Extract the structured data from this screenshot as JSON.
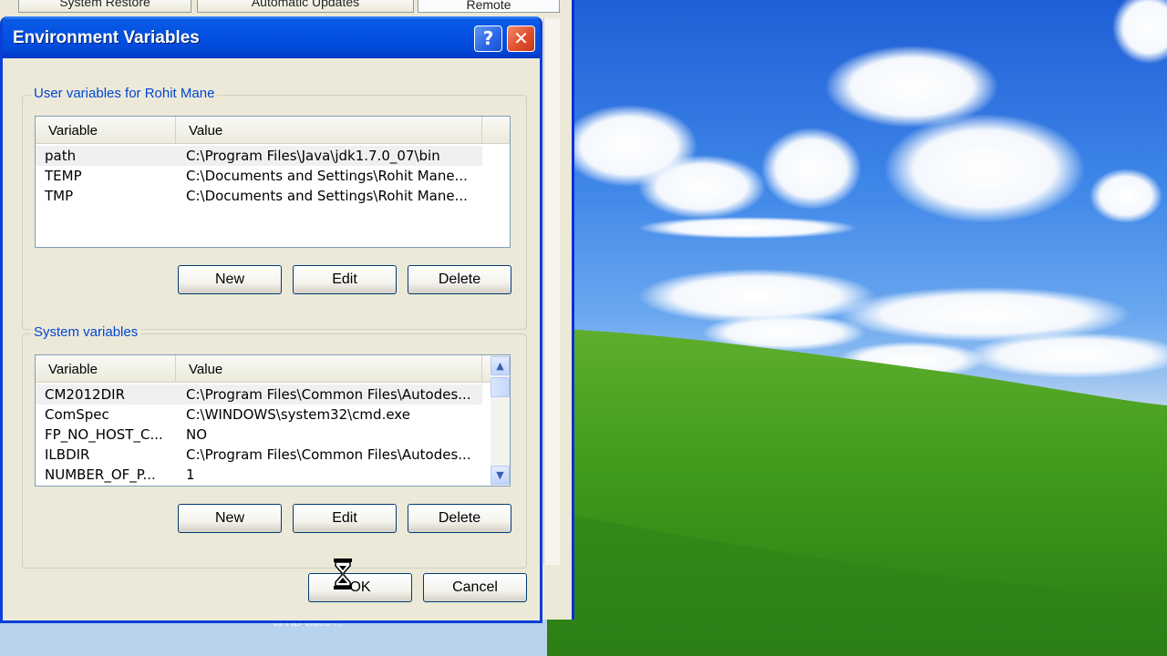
{
  "window": {
    "title": "Environment Variables",
    "help_glyph": "?",
    "close_glyph": "✕"
  },
  "background_window": {
    "tabs": [
      "System Restore",
      "Automatic Updates",
      "Remote"
    ],
    "caption": "to HD video ..."
  },
  "user_vars": {
    "group_label": "User variables for Rohit Mane",
    "columns": [
      "Variable",
      "Value"
    ],
    "rows": [
      {
        "variable": "path",
        "value": "C:\\Program Files\\Java\\jdk1.7.0_07\\bin"
      },
      {
        "variable": "TEMP",
        "value": "C:\\Documents and Settings\\Rohit Mane..."
      },
      {
        "variable": "TMP",
        "value": "C:\\Documents and Settings\\Rohit Mane..."
      }
    ],
    "buttons": {
      "new": "New",
      "edit": "Edit",
      "delete": "Delete"
    }
  },
  "system_vars": {
    "group_label": "System variables",
    "columns": [
      "Variable",
      "Value"
    ],
    "rows": [
      {
        "variable": "CM2012DIR",
        "value": "C:\\Program Files\\Common Files\\Autodes..."
      },
      {
        "variable": "ComSpec",
        "value": "C:\\WINDOWS\\system32\\cmd.exe"
      },
      {
        "variable": "FP_NO_HOST_C...",
        "value": "NO"
      },
      {
        "variable": "ILBDIR",
        "value": "C:\\Program Files\\Common Files\\Autodes..."
      },
      {
        "variable": "NUMBER_OF_P...",
        "value": "1"
      }
    ],
    "buttons": {
      "new": "New",
      "edit": "Edit",
      "delete": "Delete"
    }
  },
  "footer": {
    "ok": "OK",
    "cancel": "Cancel"
  },
  "cursor": "hourglass-icon"
}
